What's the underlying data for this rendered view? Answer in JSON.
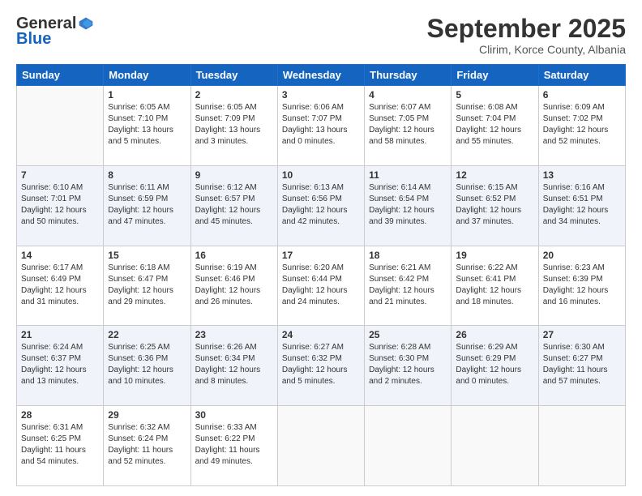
{
  "header": {
    "logo_general": "General",
    "logo_blue": "Blue",
    "month": "September 2025",
    "location": "Clirim, Korce County, Albania"
  },
  "days_of_week": [
    "Sunday",
    "Monday",
    "Tuesday",
    "Wednesday",
    "Thursday",
    "Friday",
    "Saturday"
  ],
  "weeks": [
    [
      {
        "day": "",
        "content": ""
      },
      {
        "day": "1",
        "content": "Sunrise: 6:05 AM\nSunset: 7:10 PM\nDaylight: 13 hours\nand 5 minutes."
      },
      {
        "day": "2",
        "content": "Sunrise: 6:05 AM\nSunset: 7:09 PM\nDaylight: 13 hours\nand 3 minutes."
      },
      {
        "day": "3",
        "content": "Sunrise: 6:06 AM\nSunset: 7:07 PM\nDaylight: 13 hours\nand 0 minutes."
      },
      {
        "day": "4",
        "content": "Sunrise: 6:07 AM\nSunset: 7:05 PM\nDaylight: 12 hours\nand 58 minutes."
      },
      {
        "day": "5",
        "content": "Sunrise: 6:08 AM\nSunset: 7:04 PM\nDaylight: 12 hours\nand 55 minutes."
      },
      {
        "day": "6",
        "content": "Sunrise: 6:09 AM\nSunset: 7:02 PM\nDaylight: 12 hours\nand 52 minutes."
      }
    ],
    [
      {
        "day": "7",
        "content": "Sunrise: 6:10 AM\nSunset: 7:01 PM\nDaylight: 12 hours\nand 50 minutes."
      },
      {
        "day": "8",
        "content": "Sunrise: 6:11 AM\nSunset: 6:59 PM\nDaylight: 12 hours\nand 47 minutes."
      },
      {
        "day": "9",
        "content": "Sunrise: 6:12 AM\nSunset: 6:57 PM\nDaylight: 12 hours\nand 45 minutes."
      },
      {
        "day": "10",
        "content": "Sunrise: 6:13 AM\nSunset: 6:56 PM\nDaylight: 12 hours\nand 42 minutes."
      },
      {
        "day": "11",
        "content": "Sunrise: 6:14 AM\nSunset: 6:54 PM\nDaylight: 12 hours\nand 39 minutes."
      },
      {
        "day": "12",
        "content": "Sunrise: 6:15 AM\nSunset: 6:52 PM\nDaylight: 12 hours\nand 37 minutes."
      },
      {
        "day": "13",
        "content": "Sunrise: 6:16 AM\nSunset: 6:51 PM\nDaylight: 12 hours\nand 34 minutes."
      }
    ],
    [
      {
        "day": "14",
        "content": "Sunrise: 6:17 AM\nSunset: 6:49 PM\nDaylight: 12 hours\nand 31 minutes."
      },
      {
        "day": "15",
        "content": "Sunrise: 6:18 AM\nSunset: 6:47 PM\nDaylight: 12 hours\nand 29 minutes."
      },
      {
        "day": "16",
        "content": "Sunrise: 6:19 AM\nSunset: 6:46 PM\nDaylight: 12 hours\nand 26 minutes."
      },
      {
        "day": "17",
        "content": "Sunrise: 6:20 AM\nSunset: 6:44 PM\nDaylight: 12 hours\nand 24 minutes."
      },
      {
        "day": "18",
        "content": "Sunrise: 6:21 AM\nSunset: 6:42 PM\nDaylight: 12 hours\nand 21 minutes."
      },
      {
        "day": "19",
        "content": "Sunrise: 6:22 AM\nSunset: 6:41 PM\nDaylight: 12 hours\nand 18 minutes."
      },
      {
        "day": "20",
        "content": "Sunrise: 6:23 AM\nSunset: 6:39 PM\nDaylight: 12 hours\nand 16 minutes."
      }
    ],
    [
      {
        "day": "21",
        "content": "Sunrise: 6:24 AM\nSunset: 6:37 PM\nDaylight: 12 hours\nand 13 minutes."
      },
      {
        "day": "22",
        "content": "Sunrise: 6:25 AM\nSunset: 6:36 PM\nDaylight: 12 hours\nand 10 minutes."
      },
      {
        "day": "23",
        "content": "Sunrise: 6:26 AM\nSunset: 6:34 PM\nDaylight: 12 hours\nand 8 minutes."
      },
      {
        "day": "24",
        "content": "Sunrise: 6:27 AM\nSunset: 6:32 PM\nDaylight: 12 hours\nand 5 minutes."
      },
      {
        "day": "25",
        "content": "Sunrise: 6:28 AM\nSunset: 6:30 PM\nDaylight: 12 hours\nand 2 minutes."
      },
      {
        "day": "26",
        "content": "Sunrise: 6:29 AM\nSunset: 6:29 PM\nDaylight: 12 hours\nand 0 minutes."
      },
      {
        "day": "27",
        "content": "Sunrise: 6:30 AM\nSunset: 6:27 PM\nDaylight: 11 hours\nand 57 minutes."
      }
    ],
    [
      {
        "day": "28",
        "content": "Sunrise: 6:31 AM\nSunset: 6:25 PM\nDaylight: 11 hours\nand 54 minutes."
      },
      {
        "day": "29",
        "content": "Sunrise: 6:32 AM\nSunset: 6:24 PM\nDaylight: 11 hours\nand 52 minutes."
      },
      {
        "day": "30",
        "content": "Sunrise: 6:33 AM\nSunset: 6:22 PM\nDaylight: 11 hours\nand 49 minutes."
      },
      {
        "day": "",
        "content": ""
      },
      {
        "day": "",
        "content": ""
      },
      {
        "day": "",
        "content": ""
      },
      {
        "day": "",
        "content": ""
      }
    ]
  ]
}
